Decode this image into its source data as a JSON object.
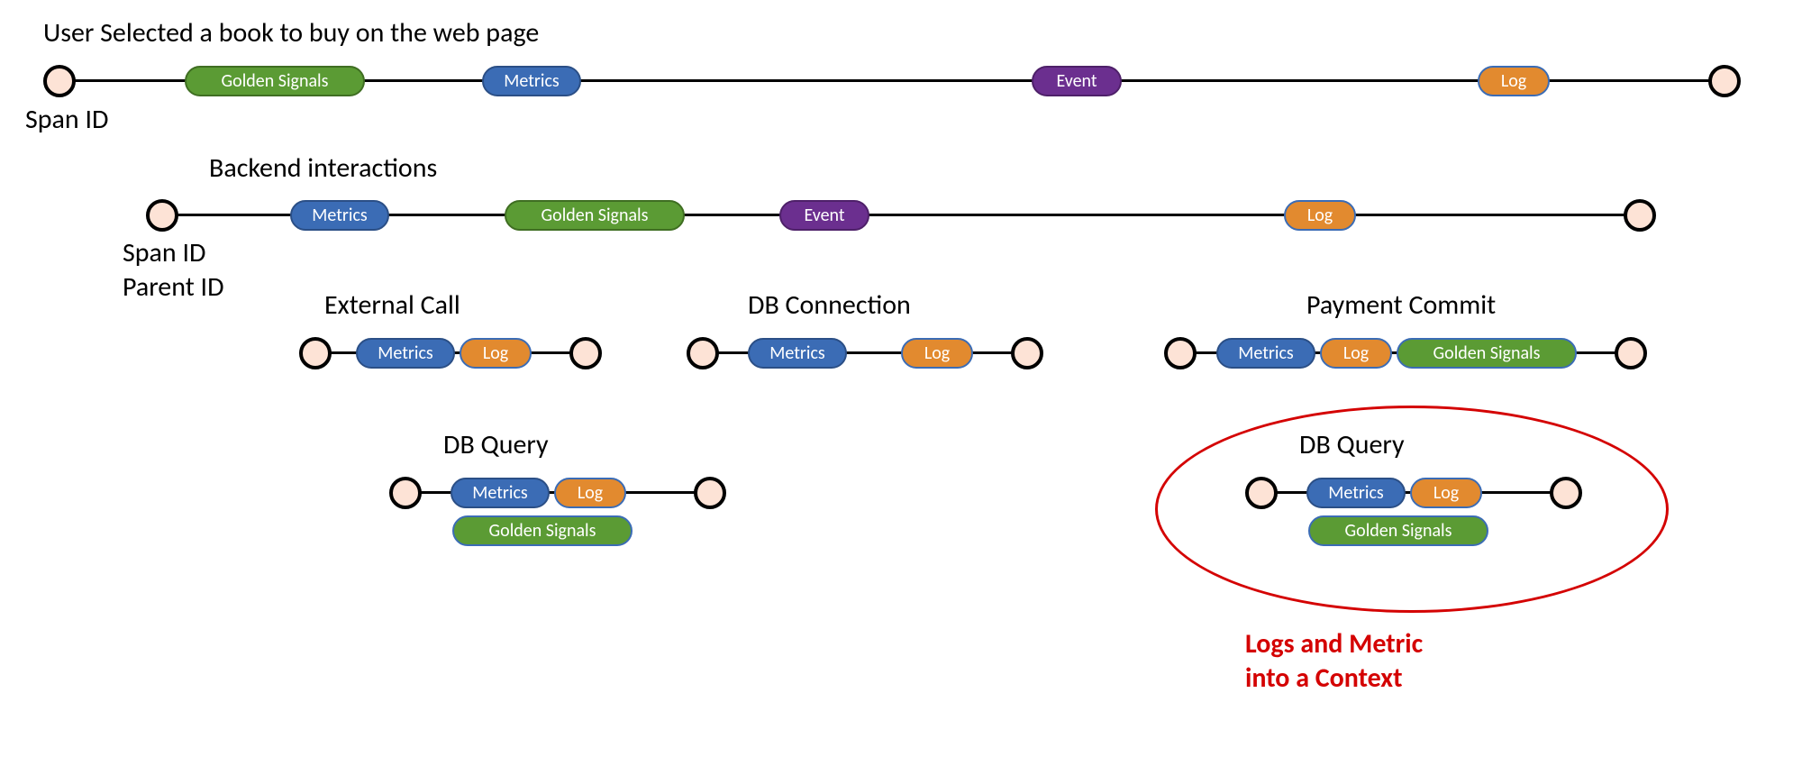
{
  "titles": {
    "row1": "User Selected a book to buy on the web page",
    "row2": "Backend interactions",
    "extcall": "External Call",
    "dbconn": "DB Connection",
    "paycommit": "Payment Commit",
    "dbquery1": "DB Query",
    "dbquery2": "DB Query"
  },
  "labels": {
    "spanid": "Span ID",
    "spanparent_line1": "Span ID",
    "spanparent_line2": "Parent ID"
  },
  "pills": {
    "golden_signals": "Golden Signals",
    "metrics": "Metrics",
    "event": "Event",
    "log": "Log"
  },
  "callout": {
    "line1": "Logs and Metric",
    "line2": "into a Context"
  },
  "colors": {
    "green": "#5b9b34",
    "blue": "#3b6cb5",
    "purple": "#6b2f8f",
    "orange": "#e28a2f",
    "red": "#d40202",
    "node_fill": "#fde3d6"
  }
}
